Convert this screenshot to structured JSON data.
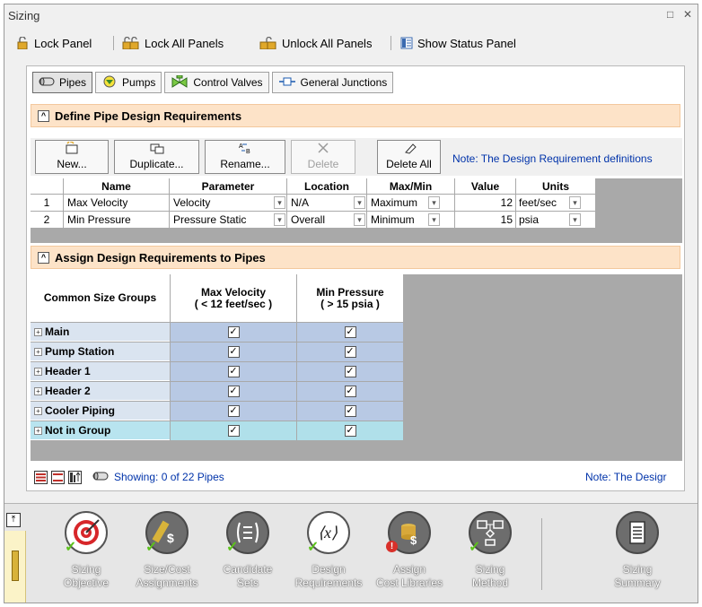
{
  "window": {
    "title": "Sizing",
    "controls": [
      "□",
      "✕"
    ]
  },
  "toolbar": {
    "lock_panel": "Lock Panel",
    "lock_all": "Lock All Panels",
    "unlock_all": "Unlock All Panels",
    "show_status": "Show Status Panel"
  },
  "tabs": [
    {
      "label": "Pipes",
      "icon": "pipe-icon",
      "active": true
    },
    {
      "label": "Pumps",
      "icon": "pump-icon",
      "active": false
    },
    {
      "label": "Control Valves",
      "icon": "control-valve-icon",
      "active": false
    },
    {
      "label": "General Junctions",
      "icon": "junction-icon",
      "active": false
    }
  ],
  "define_section": {
    "title": "Define Pipe Design Requirements",
    "buttons": {
      "new": "New...",
      "duplicate": "Duplicate...",
      "rename": "Rename...",
      "delete": "Delete",
      "delete_all": "Delete All"
    },
    "note": "Note: The Design Requirement definitions",
    "columns": {
      "name": "Name",
      "parameter": "Parameter",
      "location": "Location",
      "maxmin": "Max/Min",
      "value": "Value",
      "units": "Units"
    },
    "rows": [
      {
        "num": "1",
        "name": "Max Velocity",
        "parameter": "Velocity",
        "location": "N/A",
        "maxmin": "Maximum",
        "value": "12",
        "units": "feet/sec"
      },
      {
        "num": "2",
        "name": "Min Pressure",
        "parameter": "Pressure Static",
        "location": "Overall",
        "maxmin": "Minimum",
        "value": "15",
        "units": "psia"
      }
    ]
  },
  "assign_section": {
    "title": "Assign Design Requirements to Pipes",
    "corner_header": "Common Size Groups",
    "col1_header_line1": "Max Velocity",
    "col1_header_line2": "( < 12 feet/sec )",
    "col2_header_line1": "Min Pressure",
    "col2_header_line2": "( > 15 psia )",
    "rows": [
      {
        "name": "Main",
        "c1": "☑",
        "c2": "☑",
        "selected": false
      },
      {
        "name": "Pump Station",
        "c1": "☑",
        "c2": "☑",
        "selected": false
      },
      {
        "name": "Header 1",
        "c1": "☑",
        "c2": "☑",
        "selected": false
      },
      {
        "name": "Header 2",
        "c1": "☑",
        "c2": "☑",
        "selected": false
      },
      {
        "name": "Cooler Piping",
        "c1": "☑",
        "c2": "☑",
        "selected": false
      },
      {
        "name": "Not in Group",
        "c1": "☑",
        "c2": "☑",
        "selected": true
      }
    ],
    "showing": "Showing: 0 of 22 Pipes",
    "note": "Note: The Desigr"
  },
  "nav": [
    {
      "line1": "Sizing",
      "line2": "Objective",
      "icon": "target-icon"
    },
    {
      "line1": "Size/Cost",
      "line2": "Assignments",
      "icon": "ruler-dollar-icon"
    },
    {
      "line1": "Candidate",
      "line2": "Sets",
      "icon": "list-icon"
    },
    {
      "line1": "Design",
      "line2": "Requirements",
      "icon": "function-x-icon"
    },
    {
      "line1": "Assign",
      "line2": "Cost Libraries",
      "icon": "cost-library-icon"
    },
    {
      "line1": "Sizing",
      "line2": "Method",
      "icon": "flowchart-icon"
    },
    {
      "line1": "Sizing",
      "line2": "Summary",
      "icon": "document-icon"
    }
  ]
}
